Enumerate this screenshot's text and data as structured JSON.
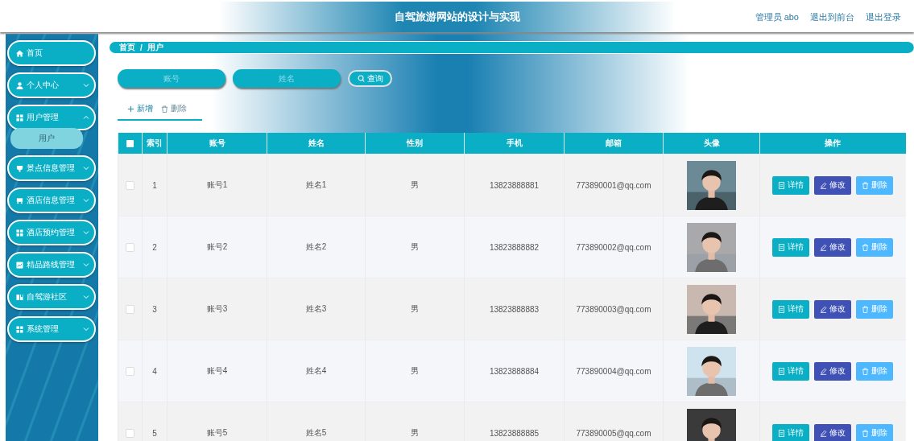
{
  "header": {
    "title": "自驾旅游网站的设计与实现",
    "user_label": "管理员 abo",
    "links": [
      "退出到前台",
      "退出登录"
    ]
  },
  "sidebar": {
    "items": [
      {
        "label": "首页",
        "expandable": false
      },
      {
        "label": "个人中心",
        "expandable": true,
        "expanded": false
      },
      {
        "label": "用户管理",
        "expandable": true,
        "expanded": true,
        "children": [
          {
            "label": "用户",
            "selected": true
          }
        ]
      },
      {
        "label": "景点信息管理",
        "expandable": true,
        "expanded": false
      },
      {
        "label": "酒店信息管理",
        "expandable": true,
        "expanded": false
      },
      {
        "label": "酒店预约管理",
        "expandable": true,
        "expanded": false
      },
      {
        "label": "精品路线管理",
        "expandable": true,
        "expanded": false
      },
      {
        "label": "自驾游社区",
        "expandable": true,
        "expanded": false
      },
      {
        "label": "系统管理",
        "expandable": true,
        "expanded": false
      }
    ]
  },
  "breadcrumb": {
    "items": [
      "首页",
      "用户"
    ],
    "separator": "/"
  },
  "search": {
    "fields": [
      {
        "placeholder": "账号"
      },
      {
        "placeholder": "姓名"
      }
    ],
    "button": "查询"
  },
  "toolbar": [
    {
      "label": "新增",
      "kind": "add"
    },
    {
      "label": "删除",
      "kind": "delete"
    }
  ],
  "table": {
    "header_checked": false,
    "columns": [
      "索引",
      "账号",
      "姓名",
      "性别",
      "手机",
      "邮箱",
      "头像",
      "操作"
    ],
    "rows": [
      {
        "checked": false,
        "cells": [
          "1",
          "账号1",
          "姓名1",
          "男",
          "13823888881",
          "773890001@qq.com"
        ],
        "actions": [
          {
            "label": "详情",
            "kind": "detail"
          },
          {
            "label": "修改",
            "kind": "edit"
          },
          {
            "label": "删除",
            "kind": "delete"
          }
        ]
      },
      {
        "checked": false,
        "cells": [
          "2",
          "账号2",
          "姓名2",
          "男",
          "13823888882",
          "773890002@qq.com"
        ],
        "actions": [
          {
            "label": "详情",
            "kind": "detail"
          },
          {
            "label": "修改",
            "kind": "edit"
          },
          {
            "label": "删除",
            "kind": "delete"
          }
        ]
      },
      {
        "checked": false,
        "cells": [
          "3",
          "账号3",
          "姓名3",
          "男",
          "13823888883",
          "773890003@qq.com"
        ],
        "actions": [
          {
            "label": "详情",
            "kind": "detail"
          },
          {
            "label": "修改",
            "kind": "edit"
          },
          {
            "label": "删除",
            "kind": "delete"
          }
        ]
      },
      {
        "checked": false,
        "cells": [
          "4",
          "账号4",
          "姓名4",
          "男",
          "13823888884",
          "773890004@qq.com"
        ],
        "actions": [
          {
            "label": "详情",
            "kind": "detail"
          },
          {
            "label": "修改",
            "kind": "edit"
          },
          {
            "label": "删除",
            "kind": "delete"
          }
        ]
      },
      {
        "checked": false,
        "cells": [
          "5",
          "账号5",
          "姓名5",
          "男",
          "13823888885",
          "773890005@qq.com"
        ],
        "actions": [
          {
            "label": "详情",
            "kind": "detail"
          },
          {
            "label": "修改",
            "kind": "edit"
          },
          {
            "label": "删除",
            "kind": "delete"
          }
        ]
      }
    ]
  }
}
